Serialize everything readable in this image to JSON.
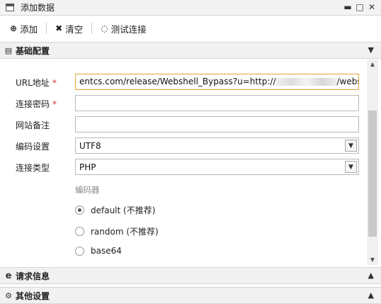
{
  "window": {
    "title": "添加数据",
    "buttons": [
      "▬",
      "□",
      "✕"
    ]
  },
  "toolbar": {
    "add_label": "添加",
    "clear_label": "清空",
    "test_label": "测试连接"
  },
  "sections": {
    "basic": "基础配置",
    "request": "请求信息",
    "other": "其他设置"
  },
  "form": {
    "url_label": "URL地址",
    "url_value_prefix": "entcs.com/release/Webshell_Bypass?u=http://",
    "url_value_suffix": "/webshell.php",
    "password_label": "连接密码",
    "password_value": "",
    "remark_label": "网站备注",
    "remark_value": "",
    "encoding_label": "编码设置",
    "encoding_value": "UTF8",
    "type_label": "连接类型",
    "type_value": "PHP",
    "required_mark": "*"
  },
  "encoder": {
    "header": "编码器",
    "options": [
      {
        "label": "default (不推荐)",
        "selected": true
      },
      {
        "label": "random (不推荐)",
        "selected": false
      },
      {
        "label": "base64",
        "selected": false
      }
    ]
  }
}
